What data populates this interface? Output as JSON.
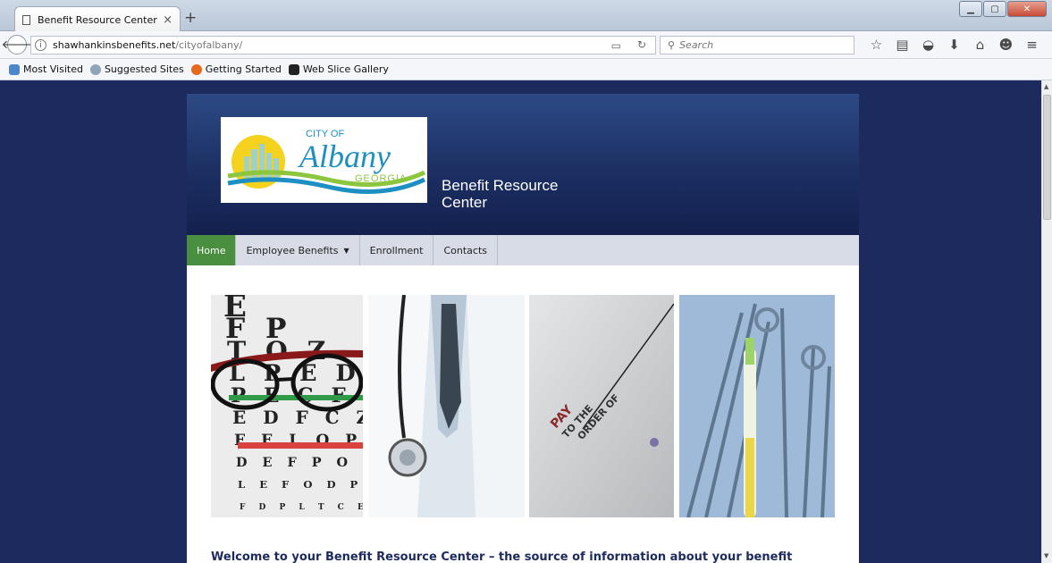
{
  "browser": {
    "tab_title": "Benefit Resource Center",
    "tab_close": "×",
    "new_tab": "+",
    "url_host": "shawhankinsbenefits.net",
    "url_path": "/cityofalbany/",
    "search_placeholder": "Search",
    "bookmarks": [
      "Most Visited",
      "Suggested Sites",
      "Getting Started",
      "Web Slice Gallery"
    ]
  },
  "site": {
    "logo": {
      "line1": "CITY OF",
      "line2": "Albany",
      "line3": "GEORGIA"
    },
    "title": "Benefit Resource Center"
  },
  "menu": {
    "home": "Home",
    "employee_benefits": "Employee Benefits",
    "enrollment": "Enrollment",
    "contacts": "Contacts"
  },
  "photos": {
    "check_text_line1": "PAY",
    "check_text_line2": "TO THE",
    "check_text_line3": "ORDER OF",
    "eye_chart_rows": [
      "E",
      "F P",
      "T O Z",
      "L P E D",
      "P E C F D",
      "E D F C Z P",
      "F E L O P Z D",
      "D E F P O T E C",
      "L E F O D P C T",
      "F D P L T C E O"
    ]
  },
  "content": {
    "welcome": "Welcome to your Benefit Resource Center – the source of information about your benefit"
  },
  "colors": {
    "page_bg": "#1d2a5e",
    "active_menu": "#4a8f3f",
    "menu_bg": "#d7dce6"
  }
}
